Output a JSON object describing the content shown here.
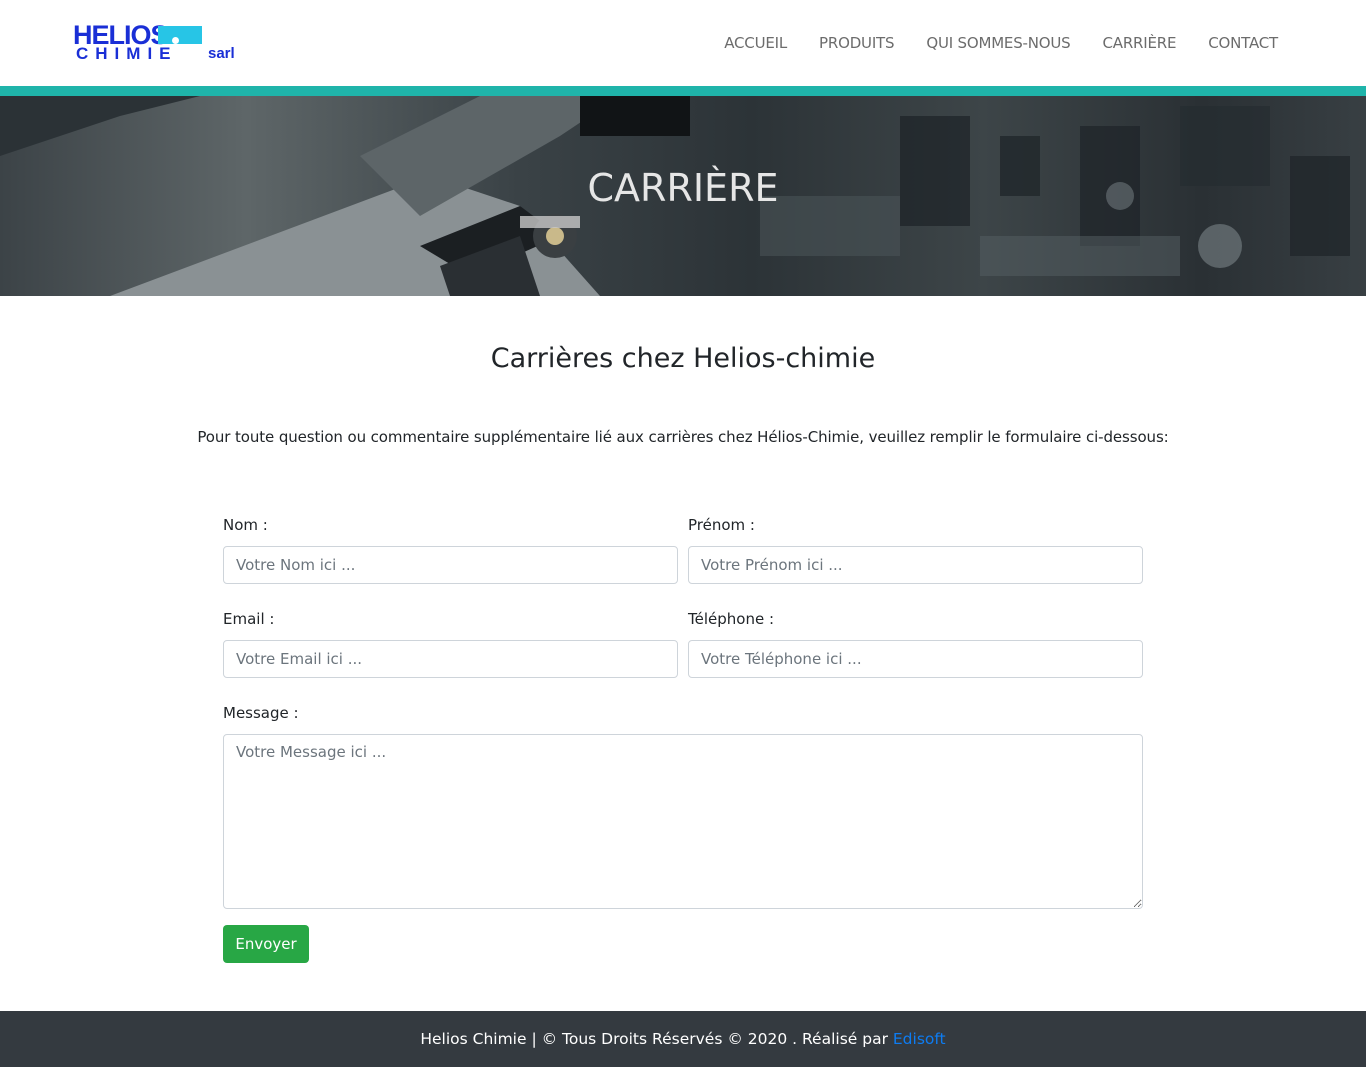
{
  "brand": {
    "logo_top": "HELIOS",
    "logo_bottom": "CHIMIE",
    "logo_suffix": "sarl",
    "colors": {
      "logo_blue": "#1a2fd6",
      "logo_cyan": "#27c5e6",
      "accent_teal": "#1fb4aa"
    }
  },
  "nav": {
    "items": [
      {
        "label": "ACCUEIL"
      },
      {
        "label": "PRODUITS"
      },
      {
        "label": "QUI SOMMES-NOUS"
      },
      {
        "label": "CARRIÈRE"
      },
      {
        "label": "CONTACT"
      }
    ]
  },
  "hero": {
    "title": "CARRIÈRE"
  },
  "main": {
    "title": "Carrières chez Helios-chimie",
    "intro": "Pour toute question ou commentaire supplémentaire lié aux carrières chez Hélios-Chimie, veuillez remplir le formulaire ci-dessous:"
  },
  "form": {
    "nom": {
      "label": "Nom :",
      "placeholder": "Votre Nom ici ..."
    },
    "prenom": {
      "label": "Prénom :",
      "placeholder": "Votre Prénom ici ..."
    },
    "email": {
      "label": "Email :",
      "placeholder": "Votre Email ici ..."
    },
    "telephone": {
      "label": "Téléphone :",
      "placeholder": "Votre Téléphone ici ..."
    },
    "message": {
      "label": "Message :",
      "placeholder": "Votre Message ici ..."
    },
    "submit_label": "Envoyer",
    "submit_color": "#28a745"
  },
  "footer": {
    "text": "Helios Chimie | © Tous Droits Réservés © 2020 . Réalisé par ",
    "link_text": "Edisoft",
    "background": "#343a40",
    "link_color": "#0d7cf2"
  }
}
